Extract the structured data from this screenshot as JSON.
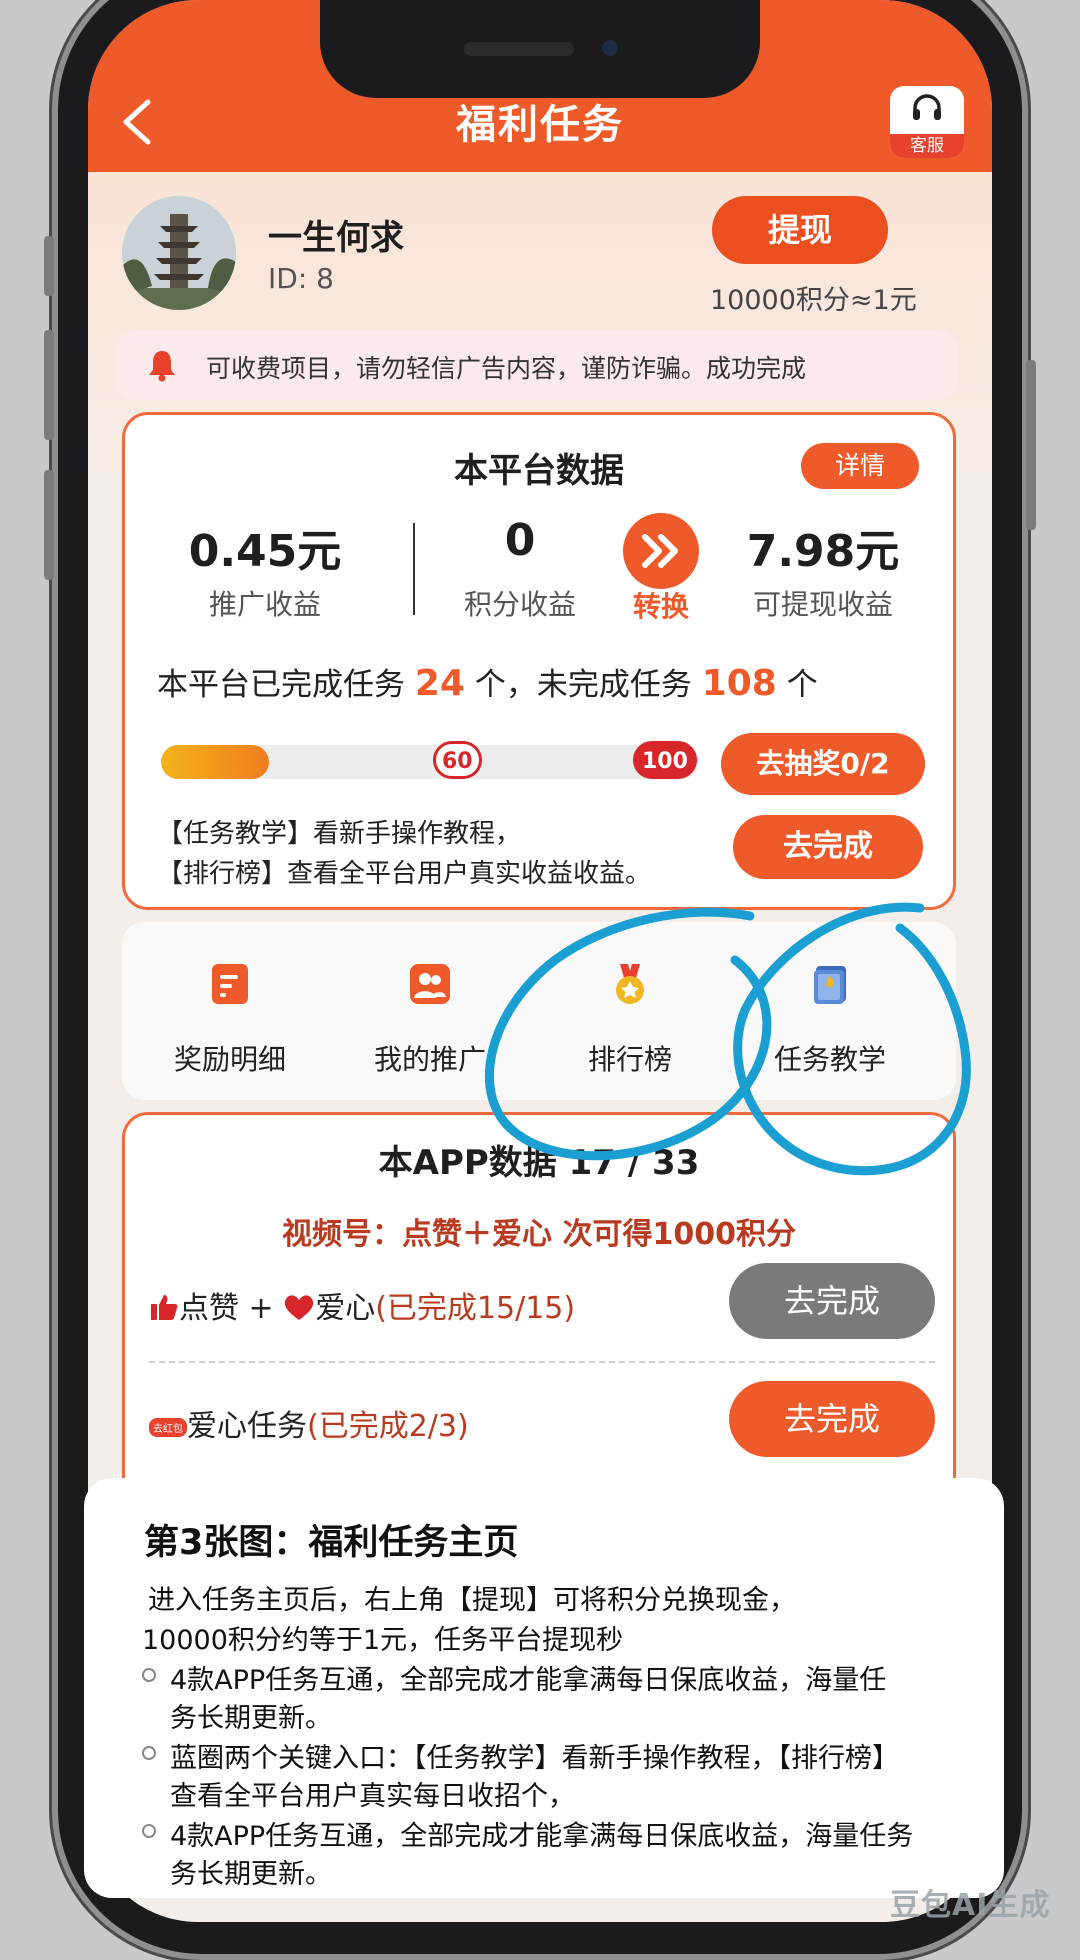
{
  "header": {
    "title": "福利任务",
    "service_label": "客服"
  },
  "user": {
    "name": "一生何求",
    "id": "ID: 8",
    "withdraw_label": "提现",
    "rate": "10000积分≈1元"
  },
  "notice": {
    "text": "可收费项目，请勿轻信广告内容，谨防诈骗。成功完成"
  },
  "platform": {
    "title": "本平台数据",
    "details_label": "详情",
    "stats": [
      {
        "value": "0.45元",
        "label": "推广收益"
      },
      {
        "value": "0",
        "label": "积分收益"
      },
      {
        "value": "7.98元",
        "label": "可提现收益"
      }
    ],
    "convert_label": "转换",
    "summary_prefix": "本平台已完成任务",
    "completed": "24",
    "summary_mid": "个，未完成任务",
    "uncompleted": "108",
    "summary_suffix": "个",
    "progress": 0.2,
    "milestones": [
      "60",
      "100"
    ],
    "lottery_label": "去抽奖0/2",
    "tip1": "【任务教学】看新手操作教程，",
    "tip2": "【排行榜】查看全平台用户真实收益收益。",
    "complete_label": "去完成"
  },
  "shortcuts": [
    {
      "label": "奖励明细",
      "icon": "document-icon"
    },
    {
      "label": "我的推广",
      "icon": "users-icon"
    },
    {
      "label": "排行榜",
      "icon": "medal-icon"
    },
    {
      "label": "任务教学",
      "icon": "book-icon"
    }
  ],
  "app_card": {
    "title": "本APP数据 17 / 33",
    "subtitle": "视频号：点赞＋爱心 次可得1000积分",
    "tasks": [
      {
        "label": "点赞 + ",
        "label2": "爱心",
        "status": "(已完成15/15)",
        "button": "去完成",
        "button_color": "#7a7a7a"
      },
      {
        "label": "爱心任务",
        "status": "(已完成2/3)",
        "button": "去完成",
        "button_color": "#ef5a2a",
        "badge": "去红包"
      }
    ]
  },
  "caption": {
    "title": "第3张图：福利任务主页",
    "lines": [
      "进入任务主页后，右上角【提现】可将积分兑换现金，",
      "10000积分约等于1元，任务平台提现秒",
      "4款APP任务互通，全部完成才能拿满每日保底收益，海量任",
      "务长期更新。",
      "蓝圈两个关键入口：【任务教学】看新手操作教程，【排行榜】",
      "查看全平台用户真实每日收招个，",
      "4款APP任务互通，全部完成才能拿满每日保底收益，海量任务",
      "务长期更新。"
    ]
  },
  "watermark": "豆包AI生成",
  "colors": {
    "brand_orange": "#ef5a2a",
    "annotation_blue": "#1b9fd3",
    "disabled_gray": "#7a7a7a"
  }
}
